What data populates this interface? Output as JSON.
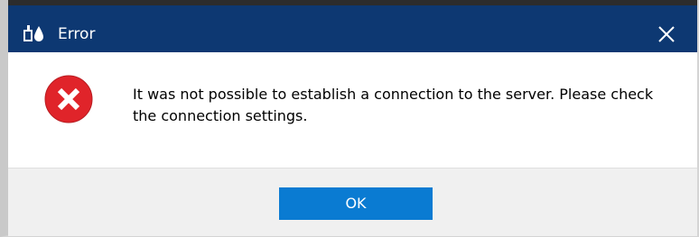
{
  "window": {
    "title": "Error",
    "app_icon": "app-logo-icon",
    "close_icon": "close-icon"
  },
  "dialog": {
    "icon": "error-icon",
    "message": "It was not possible to establish a connection to the server. Please check the connection settings."
  },
  "buttons": {
    "ok_label": "OK"
  },
  "colors": {
    "titlebar": "#0d3872",
    "error_red": "#e0242a",
    "ok_button": "#0a7bd2",
    "footer": "#f0f0f0"
  }
}
